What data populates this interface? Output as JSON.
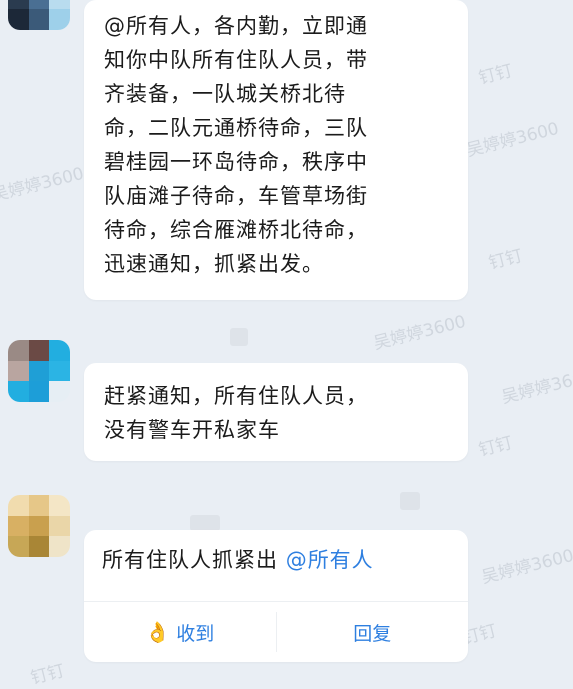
{
  "messages": [
    {
      "text": "@所有人，各内勤，立即通\n知你中队所有住队人员，带\n齐装备，一队城关桥北待\n命，二队元通桥待命，三队\n碧桂园一环岛待命，秩序中\n队庙滩子待命，车管草场街\n待命，综合雁滩桥北待命，\n迅速通知，抓紧出发。"
    },
    {
      "text": "赶紧通知，所有住队人员，\n没有警车开私家车"
    },
    {
      "text_prefix": "所有住队人抓紧出 ",
      "mention": "@所有人",
      "actions": {
        "received": "收到",
        "reply": "回复"
      }
    }
  ],
  "watermarks": [
    "钉钉",
    "吴婷婷3600",
    "吴婷婷3600",
    "钉钉",
    "吴婷婷3600",
    "吴婷婷3600",
    "钉钉",
    "吴婷婷3600",
    "钉钉",
    "吴婷婷3600",
    "钉钉"
  ],
  "colors": {
    "accent": "#2e7fe0",
    "background": "#e9eef4",
    "bubble": "#ffffff"
  },
  "icons": {
    "received": "ok-hand-icon"
  }
}
